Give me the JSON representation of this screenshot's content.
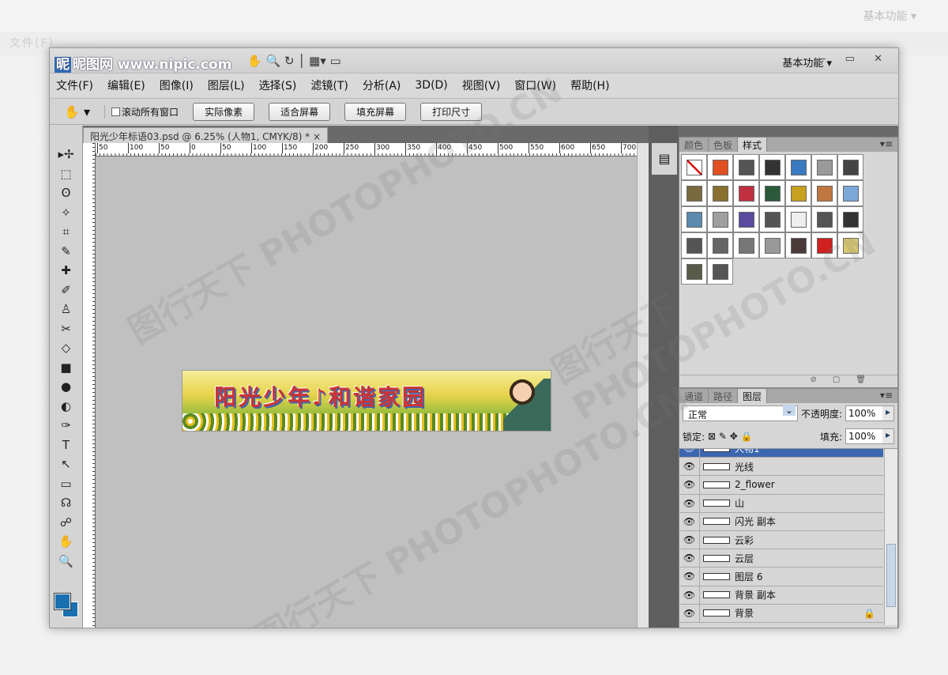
{
  "window": {
    "logo": "昵图网 www.nipic.com",
    "workspace": "基本功能 ▾",
    "controls": "– ▭ ✕"
  },
  "menu": [
    "文件(F)",
    "编辑(E)",
    "图像(I)",
    "图层(L)",
    "选择(S)",
    "滤镜(T)",
    "分析(A)",
    "3D(D)",
    "视图(V)",
    "窗口(W)",
    "帮助(H)"
  ],
  "options": {
    "scroll_all": "滚动所有窗口",
    "buttons": [
      "实际像素",
      "适合屏幕",
      "填充屏幕",
      "打印尺寸"
    ]
  },
  "document": {
    "tab": "阳光少年标语03.psd @ 6.25% (人物1, CMYK/8) *",
    "close": "×",
    "zoom": "6.25%",
    "banner_text": "阳光少年♪和谐家园"
  },
  "ruler": [
    "50",
    "100",
    "50",
    "0",
    "50",
    "100",
    "150",
    "200",
    "250",
    "300",
    "350",
    "400",
    "450",
    "500",
    "550",
    "600",
    "650",
    "700"
  ],
  "tools": [
    "▸✢",
    "⬚",
    "ʘ",
    "✧",
    "⌗",
    "✎",
    "✚",
    "✐",
    "♙",
    "✂",
    "◇",
    "■",
    "●",
    "◐",
    "✑",
    "T",
    "↖",
    "▭",
    "☊",
    "☍",
    "✋",
    "🔍"
  ],
  "foreground_color": "#1a6fb0",
  "styles_panel": {
    "tabs": [
      "颜色",
      "色板",
      "样式"
    ],
    "swatches": [
      "#ffffff",
      "#e05020",
      "#555555",
      "#333333",
      "#3a7ac0",
      "#9a9a9a",
      "#444444",
      "#7a6a40",
      "#8a7030",
      "#c03040",
      "#2a5a3a",
      "#c8a020",
      "#c07840",
      "#7aa8d8",
      "#5a8ab0",
      "#a0a0a0",
      "#5a4aa0",
      "#555555",
      "#eeeeee",
      "#555555",
      "#333333",
      "#555555",
      "#666666",
      "#777777",
      "#999999",
      "#4a3a3a",
      "#d02020",
      "#d8c870",
      "#5a5a4a",
      "#555555"
    ]
  },
  "layers_panel": {
    "tabs": [
      "通道",
      "路径",
      "图层"
    ],
    "blend_mode": "正常",
    "opacity_label": "不透明度:",
    "opacity": "100%",
    "lock_label": "锁定:",
    "fill_label": "填充:",
    "fill": "100%",
    "layers": [
      {
        "name": "人物1",
        "active": true
      },
      {
        "name": "光线"
      },
      {
        "name": "2_flower"
      },
      {
        "name": "山"
      },
      {
        "name": "闪光 副本"
      },
      {
        "name": "云彩"
      },
      {
        "name": "云层"
      },
      {
        "name": "图层 6"
      },
      {
        "name": "背景 副本"
      },
      {
        "name": "背景",
        "locked": true
      }
    ]
  },
  "watermark": "图行天下 PHOTOPHOTO.CN"
}
